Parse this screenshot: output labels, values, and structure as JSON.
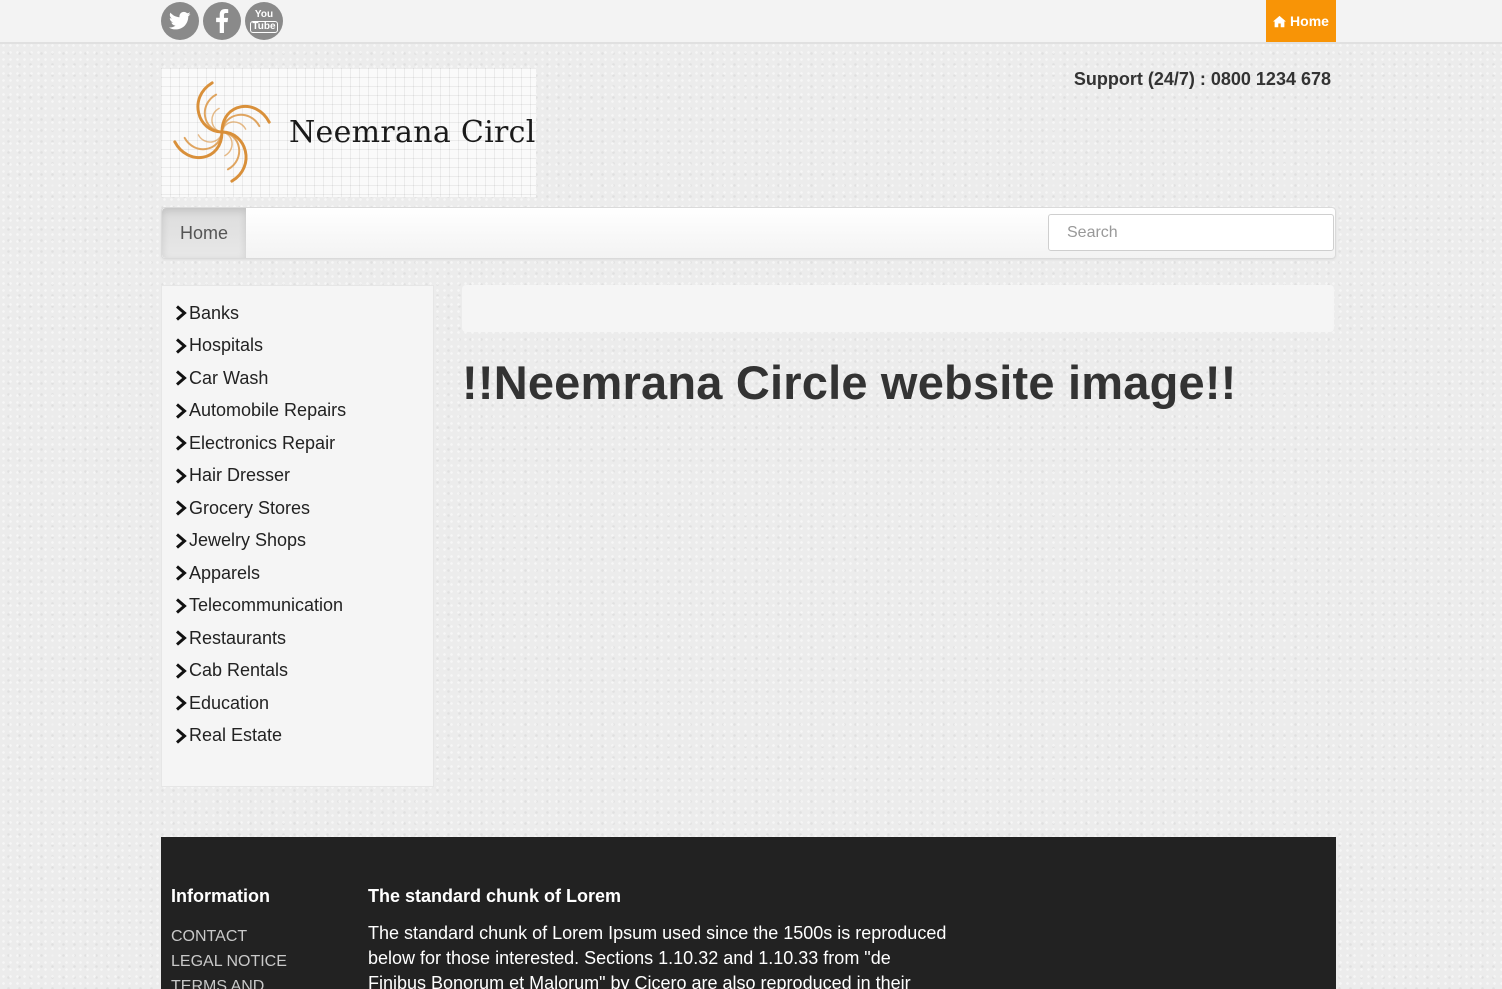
{
  "topbar": {
    "social": [
      {
        "name": "twitter-icon"
      },
      {
        "name": "facebook-icon"
      },
      {
        "name": "youtube-icon",
        "glyph_top": "You",
        "glyph_bottom": "Tube"
      }
    ],
    "home_label": "Home",
    "home_color": "#f89406"
  },
  "header": {
    "logo_text": "Neemrana Circle",
    "support": "Support (24/7) : 0800 1234 678"
  },
  "navbar": {
    "home_label": "Home",
    "search_placeholder": "Search"
  },
  "sidebar": {
    "categories": [
      "Banks",
      "Hospitals",
      "Car Wash",
      "Automobile Repairs",
      "Electronics Repair",
      "Hair Dresser",
      "Grocery Stores",
      "Jewelry Shops",
      "Apparels",
      "Telecommunication",
      "Restaurants",
      "Cab Rentals",
      "Education",
      "Real Estate"
    ]
  },
  "main": {
    "heading": "!!Neemrana Circle website image!!"
  },
  "footer": {
    "info_heading": "Information",
    "links": [
      "CONTACT",
      "LEGAL NOTICE",
      "TERMS AND"
    ],
    "lorem_heading": "The standard chunk of Lorem",
    "lorem_body": "The standard chunk of Lorem Ipsum used since the 1500s is reproduced below for those interested. Sections 1.10.32 and 1.10.33 from \"de Finibus Bonorum et Malorum\" by Cicero are also reproduced in their"
  }
}
